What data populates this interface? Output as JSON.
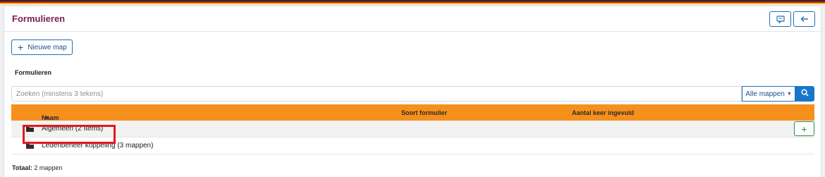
{
  "header": {
    "title": "Formulieren",
    "buttons": [
      {
        "icon": "comment-icon"
      },
      {
        "icon": "arrow-left-icon"
      }
    ]
  },
  "toolbar": {
    "new_folder_label": "Nieuwe map"
  },
  "section_title": "Formulieren",
  "search": {
    "placeholder": "Zoeken (minstens 3 tekens)",
    "filter_label": "Alle mappen",
    "search_icon": "search-icon"
  },
  "table": {
    "columns": [
      "Naam",
      "Soort formulier",
      "Aantal keer ingevuld"
    ],
    "sort_column": "Naam",
    "sort_direction": "ascending",
    "rows": [
      {
        "icon": "folder-icon",
        "name": "Algemeen (2 Items)",
        "type": "",
        "count": "",
        "highlighted": true
      },
      {
        "icon": "folder-icon",
        "name": "Ledenbeheer koppeling (3 mappen)",
        "type": "",
        "count": "",
        "highlighted": false
      }
    ]
  },
  "footer": {
    "total_label": "Totaal:",
    "total_value": "2 mappen"
  },
  "colors": {
    "title": "#7a1f4e",
    "primary": "#1877c9",
    "header_bar": "#f5901d",
    "add_button": "#2f8a53",
    "highlight": "#e3191f"
  }
}
